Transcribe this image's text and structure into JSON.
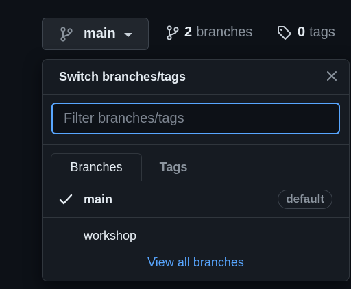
{
  "branch_button": {
    "label": "main",
    "icon": "git-branch-icon",
    "caret_icon": "triangle-down-icon"
  },
  "stats": {
    "branches": {
      "count": "2",
      "label": "branches",
      "icon": "git-branch-icon"
    },
    "tags": {
      "count": "0",
      "label": "tags",
      "icon": "tag-icon"
    }
  },
  "dropdown": {
    "title": "Switch branches/tags",
    "close_icon": "x-icon",
    "filter_placeholder": "Filter branches/tags",
    "filter_value": "",
    "tabs": [
      {
        "label": "Branches",
        "active": true
      },
      {
        "label": "Tags",
        "active": false
      }
    ],
    "branches": [
      {
        "name": "main",
        "selected": true,
        "badge": "default"
      },
      {
        "name": "workshop",
        "selected": false,
        "badge": ""
      }
    ],
    "footer_link": "View all branches"
  },
  "colors": {
    "background": "#0d1117",
    "panel": "#161b22",
    "border": "#30363d",
    "accent": "#58a6ff",
    "text": "#e6edf3",
    "muted": "#8b949e"
  }
}
